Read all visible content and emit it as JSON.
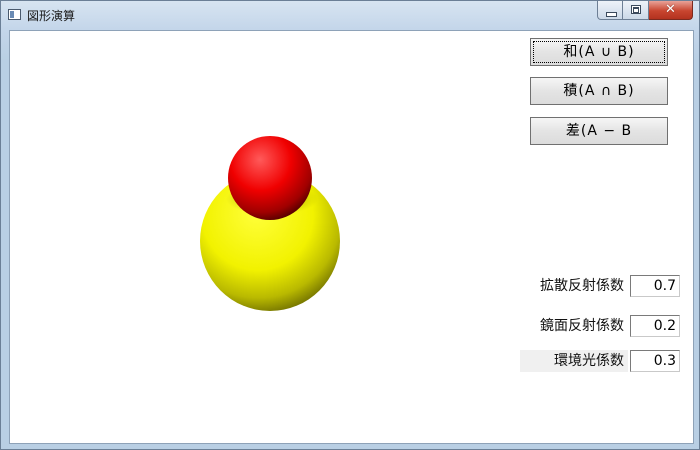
{
  "window": {
    "title": "図形演算",
    "icon": "app-window-icon",
    "caption": {
      "minimize": "minimize-icon",
      "maximize": "maximize-icon",
      "close": "✕"
    }
  },
  "operations": {
    "union": "和(A ∪ B)",
    "intersection": "積(A ∩ B)",
    "difference": "差(A − B"
  },
  "parameters": {
    "diffuse": {
      "label": "拡散反射係数",
      "value": "0.7"
    },
    "specular": {
      "label": "鏡面反射係数",
      "value": "0.2"
    },
    "ambient": {
      "label": "環境光係数",
      "value": "0.3"
    }
  },
  "scene": {
    "sphere_a_color": "#ffff00",
    "sphere_b_color": "#ff0000"
  }
}
